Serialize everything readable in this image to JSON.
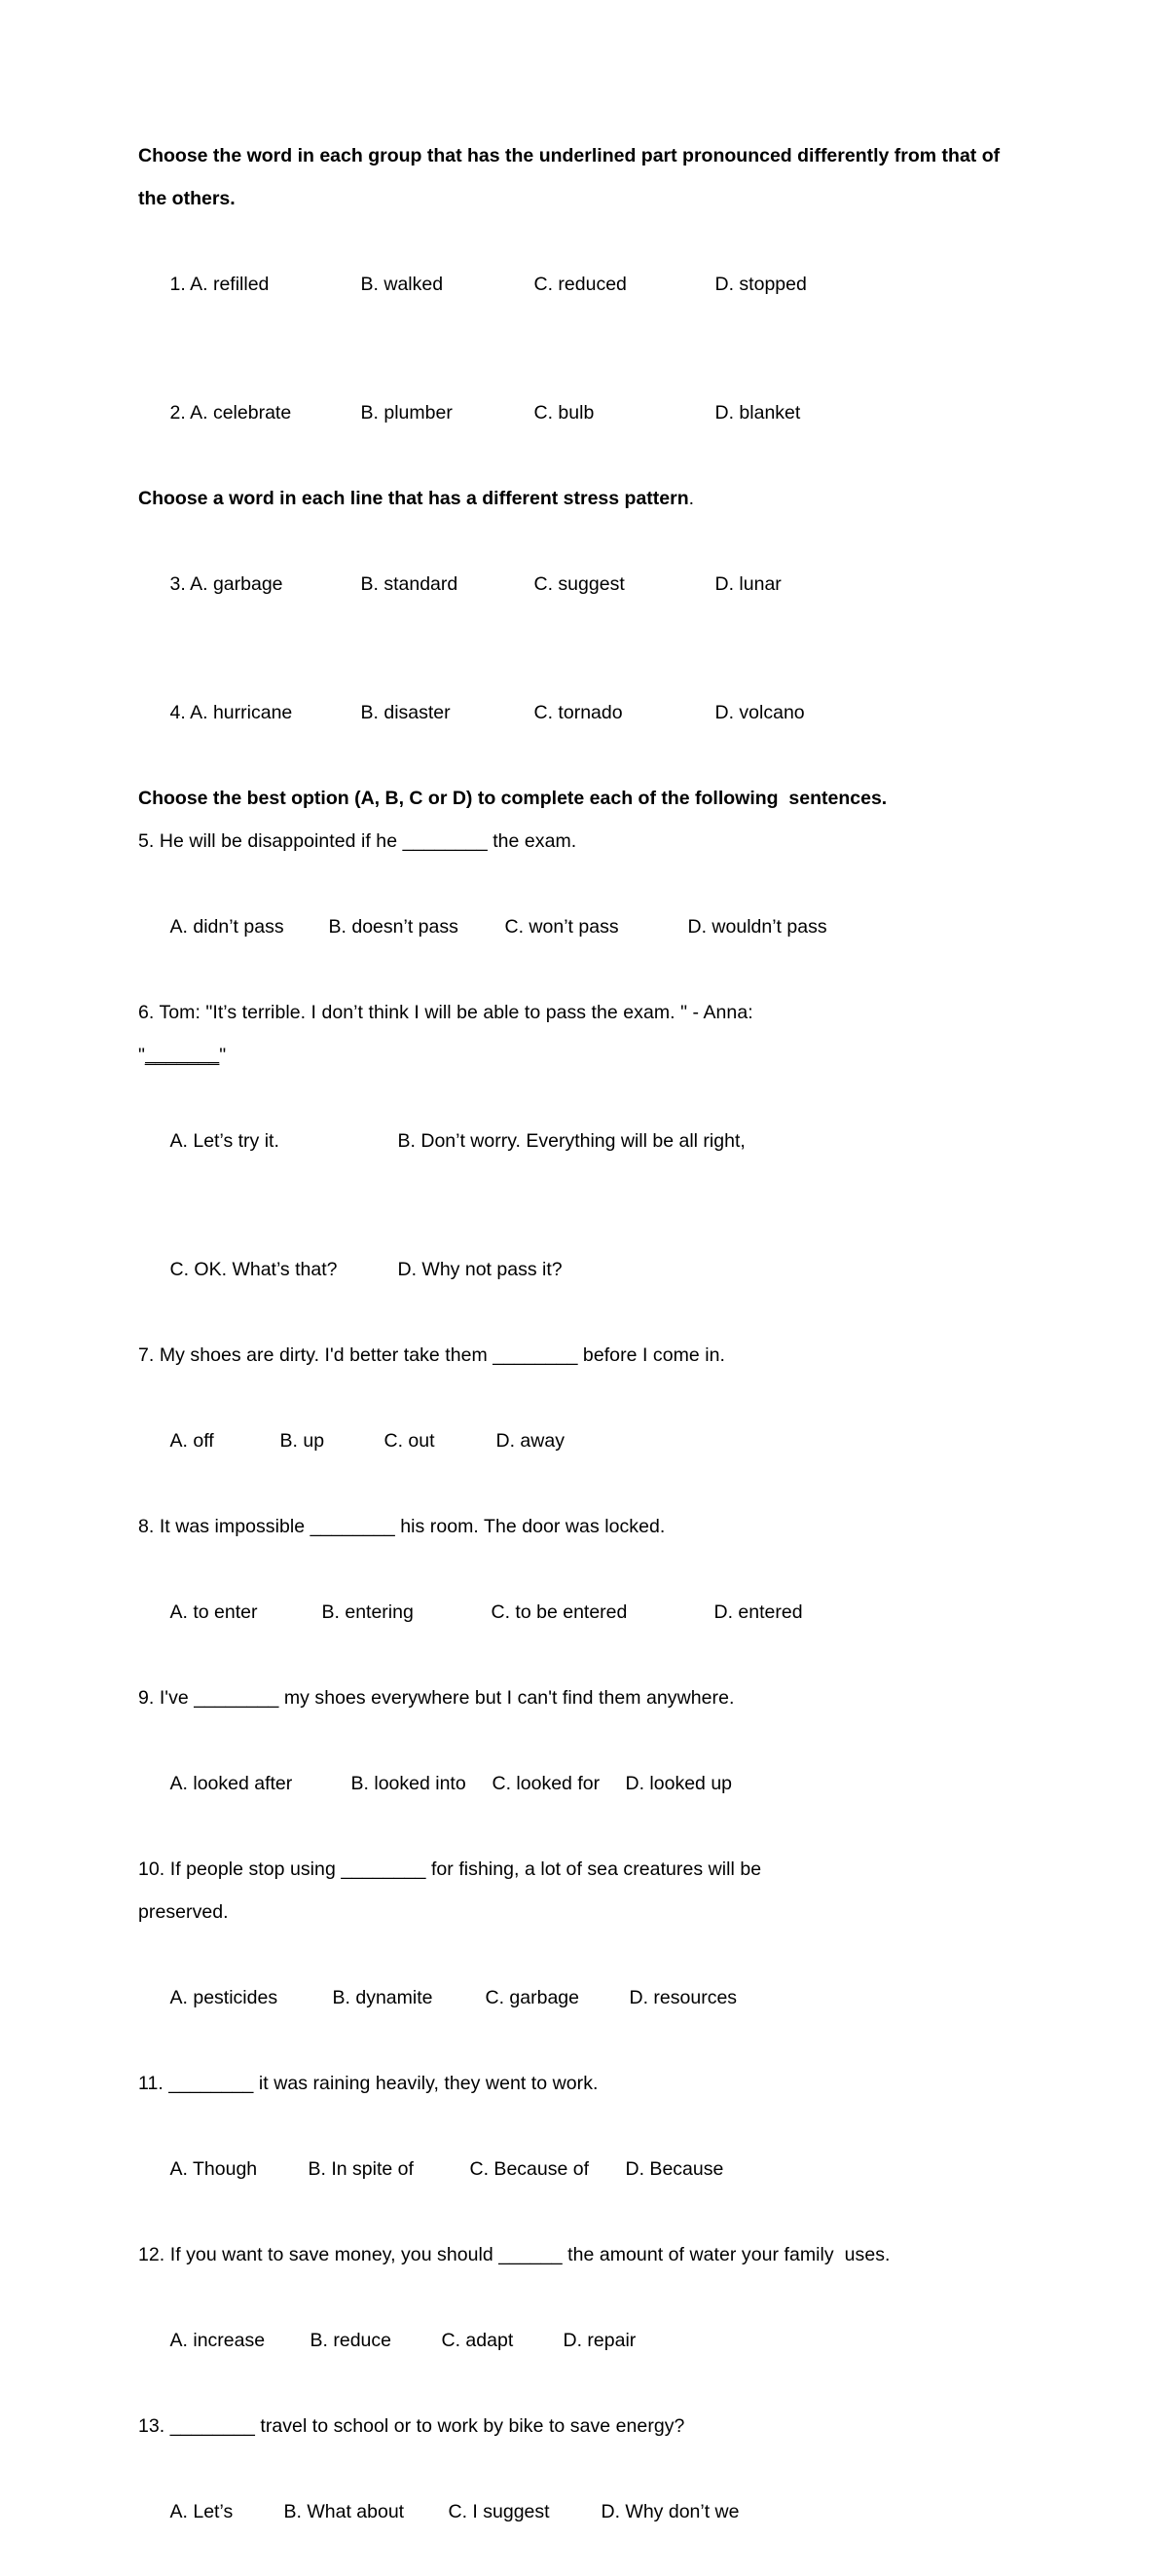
{
  "document": {
    "type": "english-exam-worksheet",
    "headings": {
      "section1": "Choose the word in each group that has the underlined part pronounced differently from that of the others.",
      "section2_main": "Choose a word in each line that has a different stress pattern",
      "section2_tail": ".",
      "section3": "Choose the best option (A, B, C or D) to complete each of the following  sentences."
    },
    "questions": [
      {
        "number": "1.",
        "inline_options": true,
        "options": [
          "1. A. refilled",
          "B. walked",
          "C. reduced",
          "D. stopped"
        ]
      },
      {
        "number": "2.",
        "inline_options": true,
        "options": [
          "2. A. celebrate",
          "B. plumber",
          "C. bulb",
          "D. blanket"
        ]
      },
      {
        "number": "3.",
        "inline_options": true,
        "options": [
          "3. A. garbage",
          "B. standard",
          "C. suggest",
          "D. lunar"
        ]
      },
      {
        "number": "4.",
        "inline_options": true,
        "options": [
          "4. A. hurricane",
          "B. disaster",
          "C. tornado",
          "D. volcano"
        ]
      },
      {
        "number": "5.",
        "stem": "5. He will be disappointed if he ________ the exam.",
        "options": [
          "A. didn’t pass",
          "B. doesn’t pass",
          "C. won’t pass",
          "D. wouldn’t pass"
        ]
      },
      {
        "number": "6.",
        "stem": "6. Tom: \"It’s terrible. I don’t think I will be able to pass the exam. \" - Anna:",
        "stem_line2_pre": "\"",
        "stem_line2_blank": "_______",
        "stem_line2_post": "\"",
        "options_row1": [
          "A. Let’s try it.",
          "B. Don’t worry. Everything will be all right,"
        ],
        "options_row2": [
          "C. OK. What’s that?",
          "D. Why not pass it?"
        ]
      },
      {
        "number": "7.",
        "stem": "7. My shoes are dirty. I'd better take them ________ before I come in.",
        "options": [
          "A. off",
          "B. up",
          "C. out",
          "D. away"
        ]
      },
      {
        "number": "8.",
        "stem": "8. It was impossible ________ his room. The door was locked.",
        "options": [
          "A. to enter",
          "B. entering",
          "C. to be entered",
          "D. entered"
        ]
      },
      {
        "number": "9.",
        "stem": "9. I've ________ my shoes everywhere but I can't find them anywhere.",
        "options": [
          "A. looked after",
          "B. looked into",
          "C. looked for",
          "D. looked up"
        ]
      },
      {
        "number": "10.",
        "stem": "10. If people stop using ________ for fishing, a lot of sea creatures will be",
        "stem_line2": "preserved.",
        "options": [
          "A. pesticides",
          "B. dynamite",
          "C. garbage",
          "D. resources"
        ]
      },
      {
        "number": "11.",
        "stem": "11. ________ it was raining heavily, they went to work.",
        "options": [
          "A. Though",
          "B. In spite of",
          "C. Because of",
          "D. Because"
        ]
      },
      {
        "number": "12.",
        "stem": "12. If you want to save money, you should ______ the amount of water your family  uses.",
        "options": [
          "A. increase",
          "B. reduce",
          "C. adapt",
          "D. repair"
        ]
      },
      {
        "number": "13.",
        "stem": "13. ________ travel to school or to work by bike to save energy?",
        "options": [
          "A. Let’s",
          "B. What about",
          "C. I suggest",
          "D. Why don’t we"
        ]
      }
    ]
  }
}
